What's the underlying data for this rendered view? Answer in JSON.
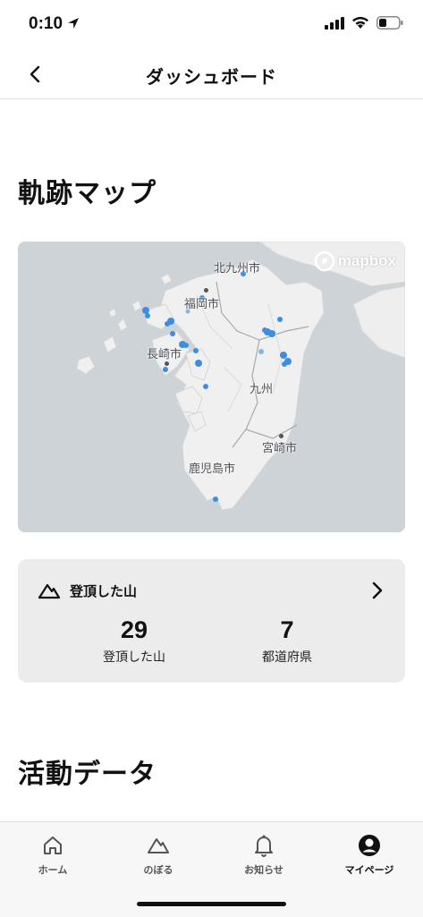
{
  "status_bar": {
    "time": "0:10"
  },
  "nav": {
    "title": "ダッシュボード"
  },
  "sections": {
    "track_map": "軌跡マップ",
    "activity": "活動データ"
  },
  "map": {
    "attribution": "mapbox",
    "labels": {
      "kitakyushu": "北九州市",
      "fukuoka": "福岡市",
      "nagasaki": "長崎市",
      "kyushu": "九州",
      "miyazaki": "宮崎市",
      "kagoshima": "鹿児島市"
    },
    "track_color": "#3d8ee3"
  },
  "summary": {
    "title": "登頂した山",
    "stats": [
      {
        "value": "29",
        "label": "登頂した山"
      },
      {
        "value": "7",
        "label": "都道府県"
      }
    ]
  },
  "tabs": [
    {
      "label": "ホーム",
      "icon": "home-icon"
    },
    {
      "label": "のぼる",
      "icon": "mountain-icon"
    },
    {
      "label": "お知らせ",
      "icon": "bell-icon"
    },
    {
      "label": "マイページ",
      "icon": "user-circle-icon",
      "active": true
    }
  ]
}
